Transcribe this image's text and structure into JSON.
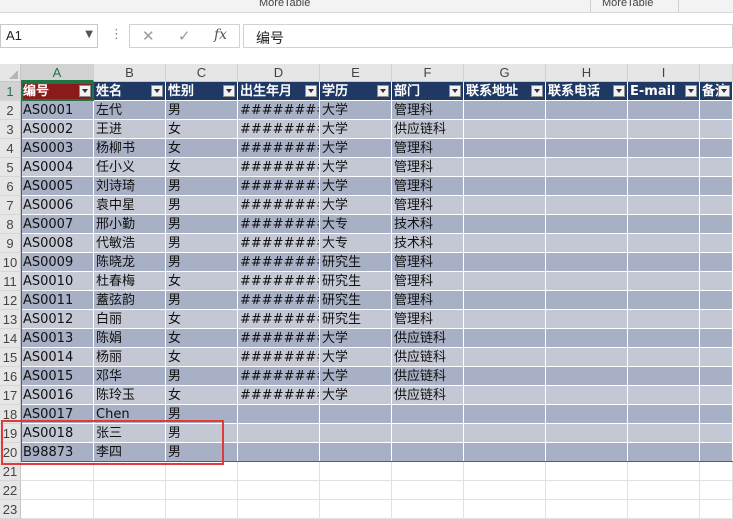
{
  "ribbon": {
    "labels": [
      "MoreTable",
      "MoreTable"
    ]
  },
  "formula_bar": {
    "name_box": "A1",
    "cancel_glyph": "✕",
    "enter_glyph": "✓",
    "fx_glyph": "fx",
    "formula_value": "编号"
  },
  "sheet": {
    "columns": [
      "A",
      "B",
      "C",
      "D",
      "E",
      "F",
      "G",
      "H",
      "I"
    ],
    "rows": [
      "1",
      "2",
      "3",
      "4",
      "5",
      "6",
      "7",
      "8",
      "9",
      "10",
      "11",
      "12",
      "13",
      "14",
      "15",
      "16",
      "17",
      "18",
      "19",
      "20",
      "21",
      "22",
      "23"
    ],
    "header": [
      "编号",
      "姓名",
      "性别",
      "出生年月",
      "学历",
      "部门",
      "联系地址",
      "联系电话",
      "E-mail",
      "备注"
    ],
    "data": [
      [
        "AS0001",
        "左代",
        "男",
        "########",
        "大学",
        "管理科"
      ],
      [
        "AS0002",
        "王进",
        "女",
        "########",
        "大学",
        "供应链科"
      ],
      [
        "AS0003",
        "杨柳书",
        "女",
        "########",
        "大学",
        "管理科"
      ],
      [
        "AS0004",
        "任小义",
        "女",
        "########",
        "大学",
        "管理科"
      ],
      [
        "AS0005",
        "刘诗琦",
        "男",
        "########",
        "大学",
        "管理科"
      ],
      [
        "AS0006",
        "袁中星",
        "男",
        "########",
        "大学",
        "管理科"
      ],
      [
        "AS0007",
        "邢小勤",
        "男",
        "########",
        "大专",
        "技术科"
      ],
      [
        "AS0008",
        "代敏浩",
        "男",
        "########",
        "大专",
        "技术科"
      ],
      [
        "AS0009",
        "陈晓龙",
        "男",
        "########",
        "研究生",
        "管理科"
      ],
      [
        "AS0010",
        "杜春梅",
        "女",
        "########",
        "研究生",
        "管理科"
      ],
      [
        "AS0011",
        "蓋弦韵",
        "男",
        "########",
        "研究生",
        "管理科"
      ],
      [
        "AS0012",
        "白丽",
        "女",
        "########",
        "研究生",
        "管理科"
      ],
      [
        "AS0013",
        "陈娟",
        "女",
        "########",
        "大学",
        "供应链科"
      ],
      [
        "AS0014",
        "杨丽",
        "女",
        "########",
        "大学",
        "供应链科"
      ],
      [
        "AS0015",
        "邓华",
        "男",
        "########",
        "大学",
        "供应链科"
      ],
      [
        "AS0016",
        "陈玲玉",
        "女",
        "########",
        "大学",
        "供应链科"
      ],
      [
        "AS0017",
        "Chen",
        "男",
        "",
        "",
        ""
      ],
      [
        "AS0018",
        "张三",
        "男",
        "",
        "",
        ""
      ],
      [
        "B98873",
        "李四",
        "男",
        "",
        "",
        ""
      ]
    ]
  },
  "colors": {
    "header_bg": "#203864",
    "active_header_bg": "#8b1a1a",
    "stripe_light": "#c4c8d4",
    "stripe_dark": "#a7b0c4",
    "selection": "#217346",
    "highlight_box": "#e03a3a"
  }
}
